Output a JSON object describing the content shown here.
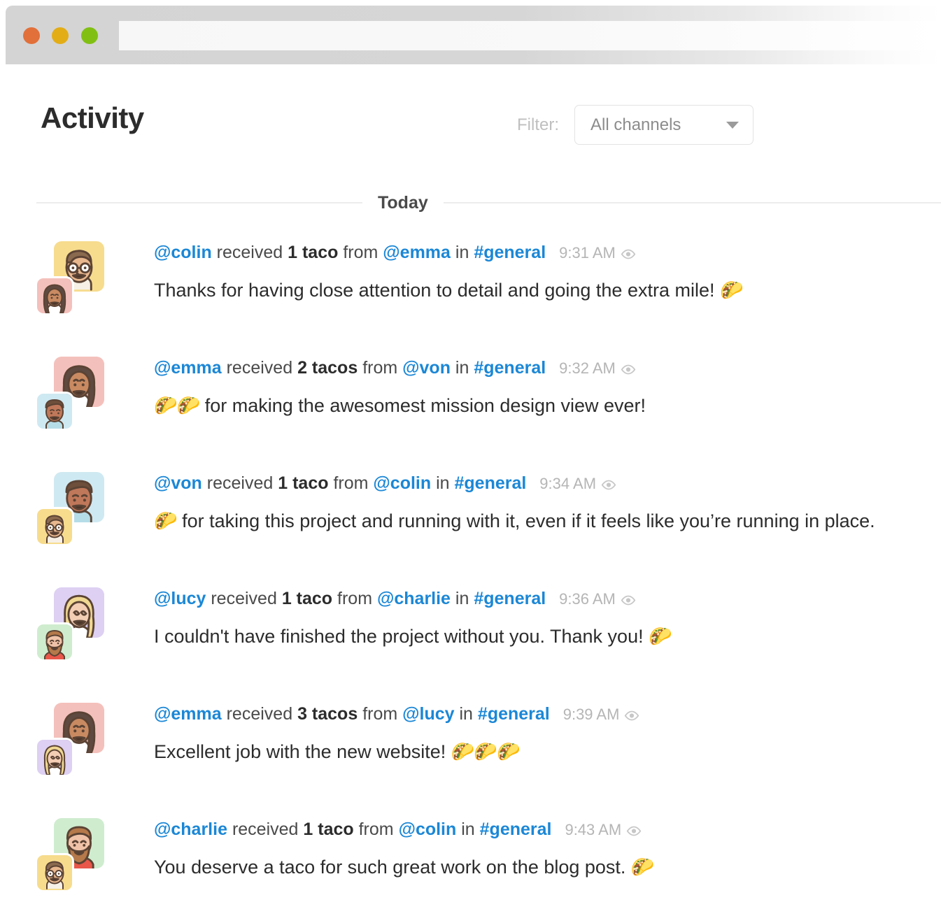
{
  "window": {
    "traffic_lights": [
      {
        "name": "close",
        "color": "#e2703a"
      },
      {
        "name": "minimize",
        "color": "#e3ad16"
      },
      {
        "name": "maximize",
        "color": "#81c013"
      }
    ]
  },
  "header": {
    "title": "Activity",
    "filter_label": "Filter:",
    "filter_value": "All channels",
    "filter_options": [
      "All channels"
    ],
    "chevron_icon": "chevron-down-icon"
  },
  "divider": {
    "label": "Today"
  },
  "accents": {
    "link_blue": "#1b87d6",
    "text_dark": "#2c2c2c",
    "muted_gray": "#b5b5b5",
    "rule_gray": "#ececec",
    "border_gray": "#e3e3e3"
  },
  "activity": [
    {
      "recipient": "@colin",
      "verb": "received",
      "amount": "1 taco",
      "from_word": "from",
      "giver": "@emma",
      "in_word": "in",
      "channel": "#general",
      "timestamp": "9:31 AM",
      "seen_icon": "eye-icon",
      "text_before": "Thanks for having close attention to detail and going the extra mile! ",
      "tacos_before": "",
      "tacos_after": "🌮",
      "avatar_large_bg": "#f7dc8e",
      "avatar_small_bg": "#f4c0bb",
      "avatar_large_char": "colin",
      "avatar_small_char": "emma"
    },
    {
      "recipient": "@emma",
      "verb": "received",
      "amount": "2 tacos",
      "from_word": "from",
      "giver": "@von",
      "in_word": "in",
      "channel": "#general",
      "timestamp": "9:32 AM",
      "seen_icon": "eye-icon",
      "text_before": " for making the awesomest mission design view ever!",
      "tacos_before": "🌮🌮",
      "tacos_after": "",
      "avatar_large_bg": "#f4c0bb",
      "avatar_small_bg": "#cfe9f2",
      "avatar_large_char": "emma",
      "avatar_small_char": "von"
    },
    {
      "recipient": "@von",
      "verb": "received",
      "amount": "1 taco",
      "from_word": "from",
      "giver": "@colin",
      "in_word": "in",
      "channel": "#general",
      "timestamp": "9:34 AM",
      "seen_icon": "eye-icon",
      "text_before": " for taking this project and running with it, even if it feels like you’re running in place.",
      "tacos_before": "🌮",
      "tacos_after": "",
      "avatar_large_bg": "#cfe9f2",
      "avatar_small_bg": "#f7dc8e",
      "avatar_large_char": "von",
      "avatar_small_char": "colin"
    },
    {
      "recipient": "@lucy",
      "verb": "received",
      "amount": "1 taco",
      "from_word": "from",
      "giver": "@charlie",
      "in_word": "in",
      "channel": "#general",
      "timestamp": "9:36 AM",
      "seen_icon": "eye-icon",
      "text_before": "I couldn't have finished the project without you. Thank you! ",
      "tacos_before": "",
      "tacos_after": "🌮",
      "avatar_large_bg": "#ddd0f2",
      "avatar_small_bg": "#cfeccf",
      "avatar_large_char": "lucy",
      "avatar_small_char": "charlie"
    },
    {
      "recipient": "@emma",
      "verb": "received",
      "amount": "3 tacos",
      "from_word": "from",
      "giver": "@lucy",
      "in_word": "in",
      "channel": "#general",
      "timestamp": "9:39 AM",
      "seen_icon": "eye-icon",
      "text_before": "Excellent job with the new website! ",
      "tacos_before": "",
      "tacos_after": "🌮🌮🌮",
      "avatar_large_bg": "#f4c0bb",
      "avatar_small_bg": "#ddd0f2",
      "avatar_large_char": "emma",
      "avatar_small_char": "lucy"
    },
    {
      "recipient": "@charlie",
      "verb": "received",
      "amount": "1 taco",
      "from_word": "from",
      "giver": "@colin",
      "in_word": "in",
      "channel": "#general",
      "timestamp": "9:43 AM",
      "seen_icon": "eye-icon",
      "text_before": "You deserve a taco for such great work on the blog post. ",
      "tacos_before": "",
      "tacos_after": "🌮",
      "avatar_large_bg": "#cfeccf",
      "avatar_small_bg": "#f7dc8e",
      "avatar_large_char": "charlie",
      "avatar_small_char": "colin"
    }
  ]
}
